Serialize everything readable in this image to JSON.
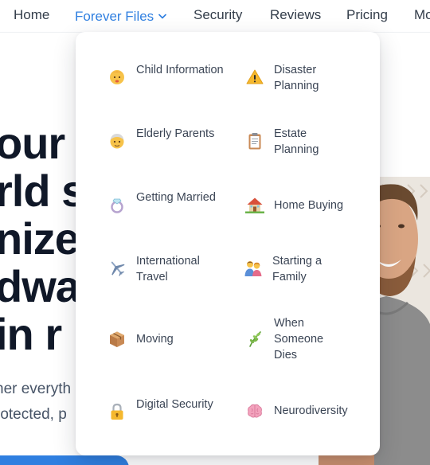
{
  "nav": {
    "items": [
      {
        "label": "Home",
        "active": false
      },
      {
        "label": "Forever Files",
        "active": true
      },
      {
        "label": "Security",
        "active": false
      },
      {
        "label": "Reviews",
        "active": false
      },
      {
        "label": "Pricing",
        "active": false
      },
      {
        "label": "Mo",
        "active": false
      }
    ],
    "active_color": "#2f7fe0"
  },
  "hero": {
    "lines": [
      "our",
      "rld s",
      "nize",
      "dwa",
      "in r"
    ],
    "sub_lines": [
      "her everyth",
      "rotected, p"
    ]
  },
  "dropdown": {
    "items": [
      {
        "label": "Child Information",
        "icon": "baby-icon"
      },
      {
        "label": "Disaster Planning",
        "icon": "warning-icon"
      },
      {
        "label": "Elderly Parents",
        "icon": "older-person-icon"
      },
      {
        "label": "Estate Planning",
        "icon": "clipboard-icon"
      },
      {
        "label": "Getting Married",
        "icon": "ring-icon"
      },
      {
        "label": "Home Buying",
        "icon": "house-icon"
      },
      {
        "label": "International Travel",
        "icon": "airplane-icon"
      },
      {
        "label": "Starting a Family",
        "icon": "family-icon"
      },
      {
        "label": "Moving",
        "icon": "package-icon"
      },
      {
        "label": "When Someone Dies",
        "icon": "herb-icon"
      },
      {
        "label": "Digital Security",
        "icon": "lock-icon"
      },
      {
        "label": "Neurodiversity",
        "icon": "brain-icon"
      }
    ]
  }
}
